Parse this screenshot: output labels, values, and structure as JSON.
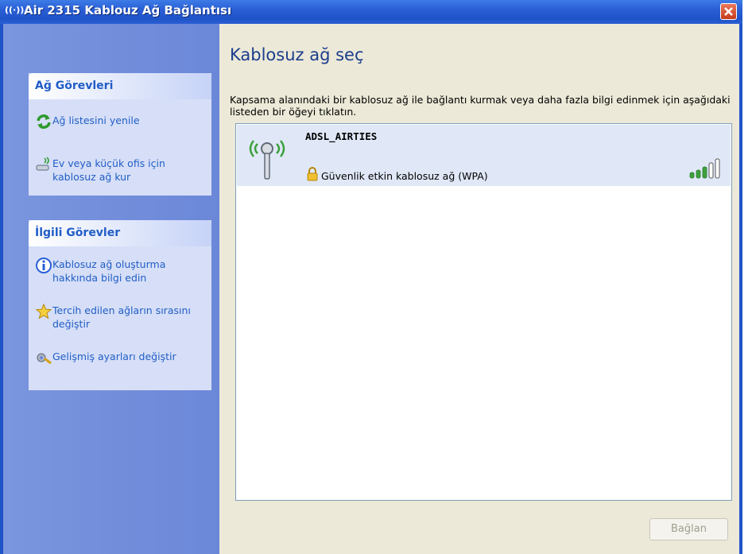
{
  "window": {
    "title": "Air 2315 Kablouz Ağ Bağlantısı",
    "title_icon": "((·))"
  },
  "sidebar": {
    "network_tasks": {
      "header": "Ağ Görevleri",
      "items": [
        {
          "label": "Ağ listesini yenile",
          "icon": "refresh-icon"
        },
        {
          "label": "Ev veya küçük ofis için kablosuz ağ kur",
          "icon": "wireless-setup-icon"
        }
      ]
    },
    "related_tasks": {
      "header": "İlgili Görevler",
      "items": [
        {
          "label": "Kablosuz ağ oluşturma hakkında bilgi edin",
          "icon": "info-icon"
        },
        {
          "label": "Tercih edilen ağların sırasını değiştir",
          "icon": "star-icon"
        },
        {
          "label": "Gelişmiş ayarları değiştir",
          "icon": "settings-icon"
        }
      ]
    }
  },
  "main": {
    "title": "Kablosuz ağ seç",
    "description": "Kapsama alanındaki bir kablosuz ağ ile bağlantı kurmak veya daha fazla bilgi edinmek için aşağıdaki listeden bir öğeyi tıklatın.",
    "networks": [
      {
        "name": "ADSL_AIRTIES",
        "security": "Güvenlik etkin kablosuz ağ (WPA)",
        "signal_bars_lit": 3,
        "signal_bars_total": 5
      }
    ],
    "connect_button": "Bağlan"
  },
  "colors": {
    "titlebar": "#2a5fd6",
    "sidebar": "#6b87d8",
    "panel_bg": "#d6dff7",
    "link_text": "#215dc6",
    "selected_item": "#e0e8f7",
    "signal_green": "#3ca13c"
  }
}
